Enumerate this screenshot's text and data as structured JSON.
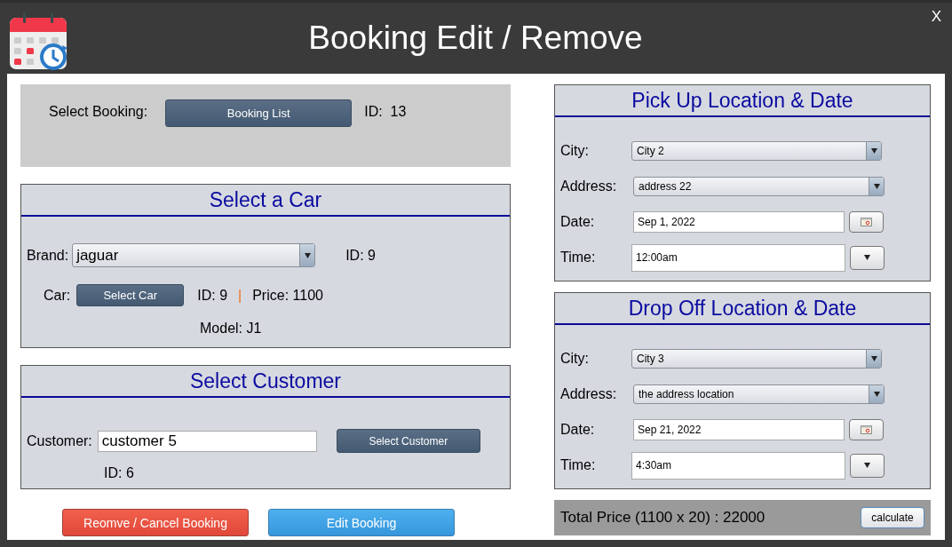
{
  "window": {
    "title": "Booking Edit / Remove",
    "close": "X"
  },
  "booking": {
    "label": "Select Booking:",
    "button": "Booking List",
    "id": "ID:  13"
  },
  "car_panel": {
    "title": "Select a Car",
    "brand_label": "Brand:",
    "brand": "jaguar",
    "brand_id": "ID: 9",
    "car_label": "Car:",
    "button": "Select Car",
    "car_id": "ID: 9",
    "separator": "|",
    "price": "Price: 1100",
    "model": "Model: J1"
  },
  "customer_panel": {
    "title": "Select Customer",
    "label": "Customer:",
    "value": "customer 5",
    "button": "Select Customer",
    "id": "ID: 6"
  },
  "pickup": {
    "title": "Pick Up Location & Date",
    "fields": [
      {
        "kind": "select",
        "label": "City:",
        "value": "City 2"
      },
      {
        "kind": "select",
        "label": "Address:",
        "value": "address 22"
      },
      {
        "kind": "date",
        "label": "Date:",
        "value": "Sep 1, 2022"
      },
      {
        "kind": "time",
        "label": "Time:",
        "value": "12:00am"
      }
    ]
  },
  "dropoff": {
    "title": "Drop Off Location & Date",
    "fields": [
      {
        "kind": "select",
        "label": "City:",
        "value": "City 3"
      },
      {
        "kind": "select",
        "label": "Address:",
        "value": "the address location"
      },
      {
        "kind": "date",
        "label": "Date:",
        "value": "Sep 21, 2022"
      },
      {
        "kind": "time",
        "label": "Time:",
        "value": "4:30am"
      }
    ]
  },
  "total": {
    "text": "Total Price (1100 x 20) : 22000",
    "button": "calculate"
  },
  "actions": [
    {
      "kind": "danger",
      "label": "Reomve / Cancel Booking"
    },
    {
      "kind": "primary",
      "label": "Edit Booking"
    }
  ]
}
